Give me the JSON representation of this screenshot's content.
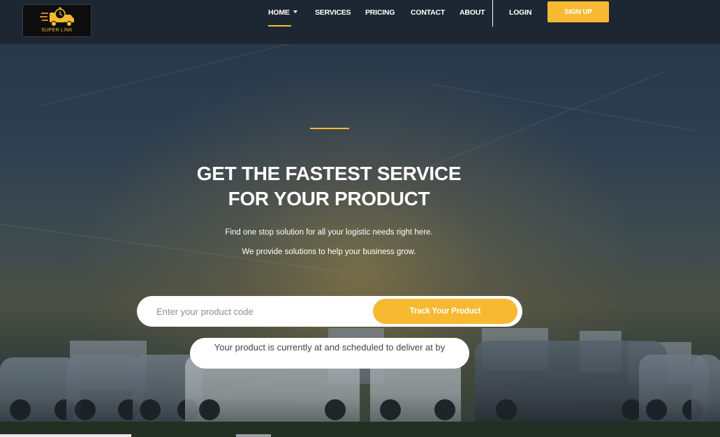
{
  "brand": {
    "name": "SUPER LINK",
    "accent_color": "#f7b932",
    "logo_icon": "delivery-truck-stopwatch-icon"
  },
  "nav": {
    "home": "HOME",
    "services": "SERVICES",
    "pricing": "PRICING",
    "contact": "CONTACT",
    "about": "ABOUT",
    "login": "LOGIN",
    "signup": "SIGN UP"
  },
  "hero": {
    "headline_line1": "GET THE FASTEST SERVICE",
    "headline_line2": "FOR YOUR PRODUCT",
    "subtitle1": "Find one stop solution for all your logistic needs right here.",
    "subtitle2": "We provide solutions to help your business grow."
  },
  "tracking": {
    "placeholder": "Enter your product code",
    "value": "",
    "button_label": "Track Your Product",
    "status_text": "Your product is currently at and scheduled to deliver at by"
  }
}
